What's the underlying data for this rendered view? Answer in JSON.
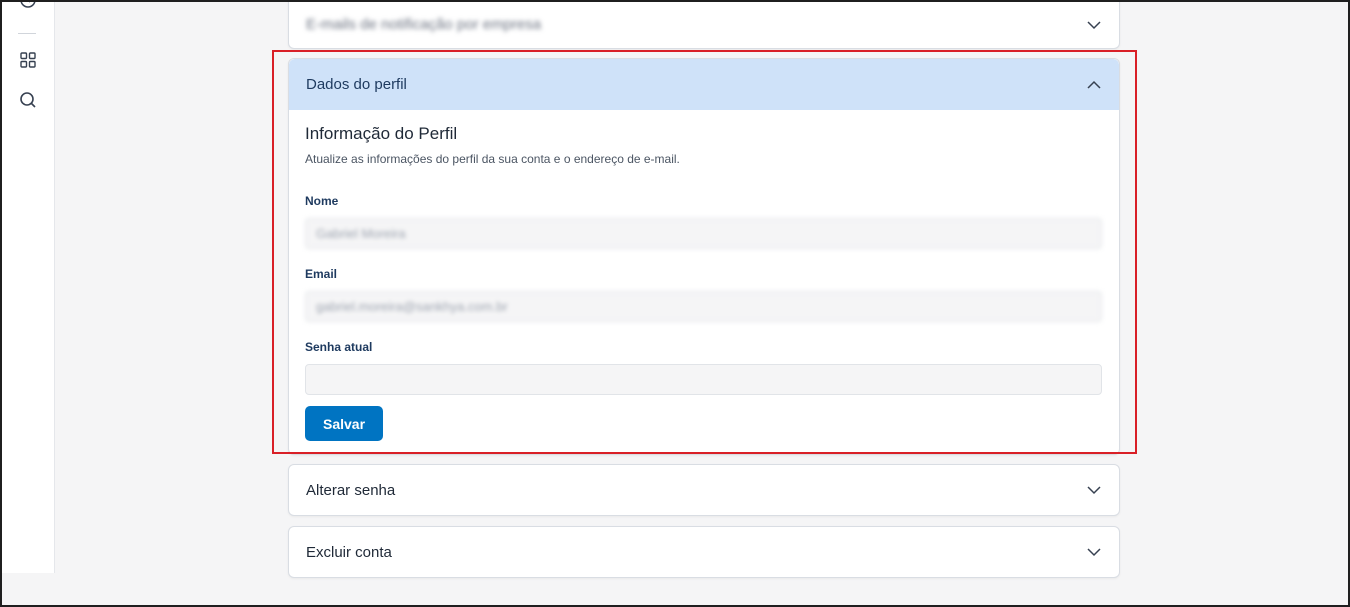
{
  "sidebar": {
    "icons": [
      "clock-icon",
      "grid-icon",
      "search-icon"
    ]
  },
  "sections": {
    "top": {
      "title": "E-mails de notificação por empresa"
    },
    "profile": {
      "header": "Dados do perfil",
      "title": "Informação do Perfil",
      "description": "Atualize as informações do perfil da sua conta e o endereço de e-mail.",
      "name_label": "Nome",
      "name_value": "Gabriel Moreira",
      "email_label": "Email",
      "email_value": "gabriel.moreira@sankhya.com.br",
      "password_label": "Senha atual",
      "password_value": "",
      "save_label": "Salvar"
    },
    "change_password": {
      "title": "Alterar senha"
    },
    "delete_account": {
      "title": "Excluir conta"
    }
  },
  "colors": {
    "accent": "#0074c2",
    "open_header_bg": "#cfe2f9",
    "highlight_border": "#d92027"
  }
}
